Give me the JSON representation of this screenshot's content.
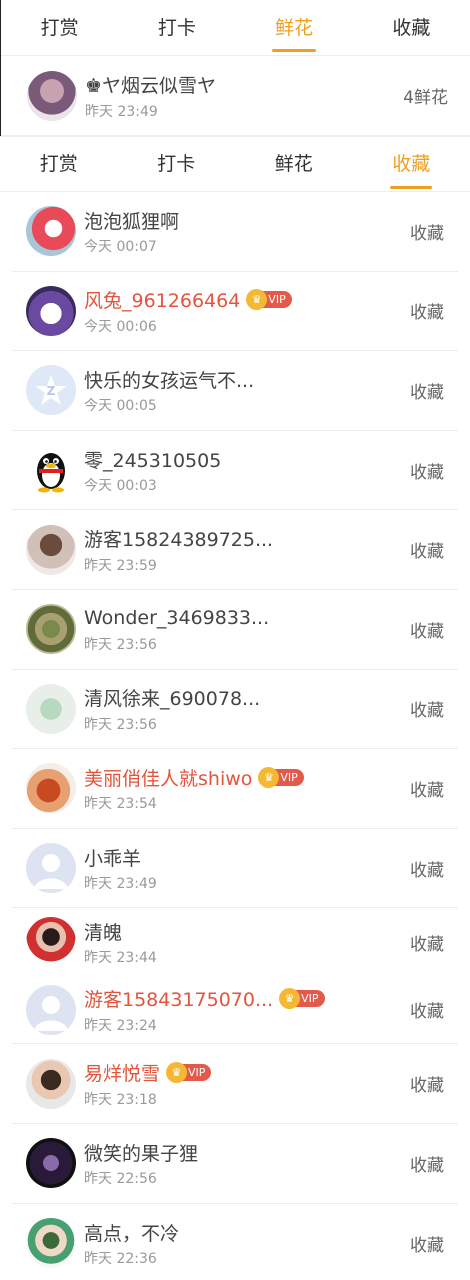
{
  "top_tabs": [
    {
      "label": "打赏",
      "active": false
    },
    {
      "label": "打卡",
      "active": false
    },
    {
      "label": "鲜花",
      "active": true
    },
    {
      "label": "收藏",
      "active": false
    }
  ],
  "top_entry": {
    "name": "♚ヤ烟云似雪ヤ",
    "time": "昨天 23:49",
    "amount": "4鲜花",
    "avatar_icon": "girl-photo-avatar"
  },
  "tabs": [
    {
      "label": "打赏",
      "active": false
    },
    {
      "label": "打卡",
      "active": false
    },
    {
      "label": "鲜花",
      "active": false
    },
    {
      "label": "收藏",
      "active": true
    }
  ],
  "vip_label": "VIP",
  "accent_color": "#f0a020",
  "vip_name_color": "#e2553c",
  "rows": [
    {
      "name": "泡泡狐狸啊",
      "time": "今天 00:07",
      "action": "收藏",
      "vip": false,
      "avatar": "red-cartoon-avatar"
    },
    {
      "name": "风兔_961266464",
      "time": "今天 00:06",
      "action": "收藏",
      "vip": true,
      "avatar": "bunny-avatar"
    },
    {
      "name": "快乐的女孩运气不...",
      "time": "今天 00:05",
      "action": "收藏",
      "vip": false,
      "avatar": "qzone-star-avatar"
    },
    {
      "name": "零_245310505",
      "time": "今天 00:03",
      "action": "收藏",
      "vip": false,
      "avatar": "qq-penguin-avatar"
    },
    {
      "name": "游客15824389725...",
      "time": "昨天 23:59",
      "action": "收藏",
      "vip": false,
      "avatar": "girl-photo-avatar"
    },
    {
      "name": "Wonder_3469833...",
      "time": "昨天 23:56",
      "action": "收藏",
      "vip": false,
      "avatar": "moss-avatar"
    },
    {
      "name": "清风徐来_690078...",
      "time": "昨天 23:56",
      "action": "收藏",
      "vip": false,
      "avatar": "flower-avatar"
    },
    {
      "name": "美丽俏佳人就shiwo",
      "time": "昨天 23:54",
      "action": "收藏",
      "vip": true,
      "avatar": "food-avatar"
    },
    {
      "name": "小乖羊",
      "time": "昨天 23:49",
      "action": "收藏",
      "vip": false,
      "avatar": "default-person-avatar"
    },
    {
      "name": "清魄",
      "time": "昨天 23:44",
      "action": "收藏",
      "vip": false,
      "avatar": "lady-costume-avatar"
    },
    {
      "name": "游客15843175070...",
      "time": "昨天 23:24",
      "action": "收藏",
      "vip": true,
      "avatar": "default-person-avatar"
    },
    {
      "name": "易烊悦雪",
      "time": "昨天 23:18",
      "action": "收藏",
      "vip": true,
      "avatar": "boy-photo-avatar"
    },
    {
      "name": "微笑的果子狸",
      "time": "昨天 22:56",
      "action": "收藏",
      "vip": false,
      "avatar": "night-avatar"
    },
    {
      "name": "高点，不冷",
      "time": "昨天 22:36",
      "action": "收藏",
      "vip": false,
      "avatar": "anime-avatar"
    }
  ]
}
